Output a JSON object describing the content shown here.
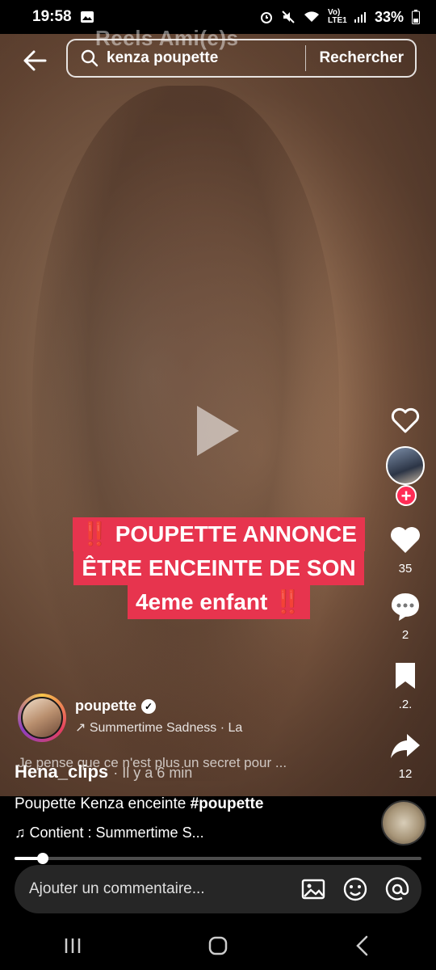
{
  "status_bar": {
    "time": "19:58",
    "network": "Vo) LTE1",
    "battery": "33%"
  },
  "header": {
    "ghost_tabs": "Reels   Ami(e)s",
    "search_query": "kenza poupette",
    "search_button": "Rechercher"
  },
  "video": {
    "caption_lines": [
      "‼️ POUPETTE ANNONCE",
      "ÊTRE ENCEINTE DE SON",
      "4eme enfant ‼️"
    ],
    "embedded_author": "poupette",
    "embedded_sound": "↗ Summertime Sadness · La",
    "embedded_description": "Je pense que ce n'est plus un secret pour ..."
  },
  "rail": {
    "like_count": "35",
    "comment_count": "2",
    "save_count": ".2.",
    "share_count": "12"
  },
  "post": {
    "author": "Hena_clips",
    "time_ago": "· Il y a 6 min",
    "description_text": "Poupette Kenza enceinte ",
    "hashtag": "#poupette",
    "music": "♫ Contient : Summertime S..."
  },
  "progress": {
    "fraction": 0.07
  },
  "comment": {
    "placeholder": "Ajouter un commentaire..."
  },
  "colors": {
    "caption_bg": "#e7344e",
    "follow_badge": "#ff2c55"
  }
}
